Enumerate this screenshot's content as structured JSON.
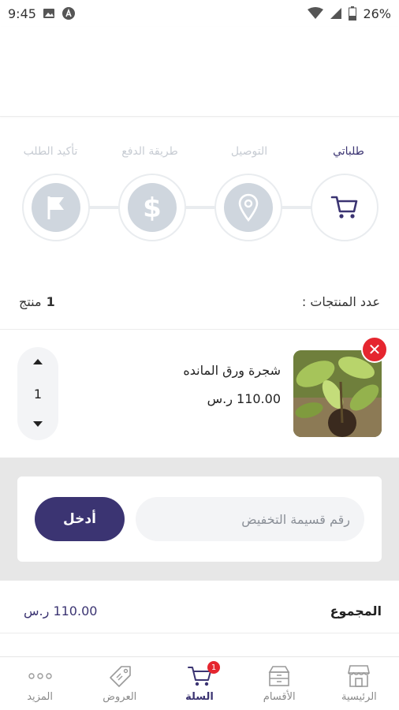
{
  "status_bar": {
    "time": "9:45",
    "battery": "26%",
    "icons": [
      "image-icon",
      "notification-a-icon",
      "wifi-icon",
      "signal-icon",
      "battery-icon"
    ]
  },
  "stepper": {
    "steps": [
      {
        "label": "طلباتي",
        "icon": "cart-icon",
        "active": true
      },
      {
        "label": "التوصيل",
        "icon": "location-pin-icon",
        "active": false
      },
      {
        "label": "طريقة الدفع",
        "icon": "dollar-icon",
        "active": false
      },
      {
        "label": "تأكيد الطلب",
        "icon": "flag-icon",
        "active": false
      }
    ]
  },
  "cart": {
    "count_label": "عدد المنتجات :",
    "count_number": "1",
    "count_unit": "منتج",
    "items": [
      {
        "name": "شجرة ورق المانده",
        "price": "110.00 ر.س",
        "quantity": "1"
      }
    ]
  },
  "coupon": {
    "placeholder": "رقم قسيمة التخفيض",
    "submit_label": "أدخل"
  },
  "total": {
    "label": "المجموع",
    "value": "110.00 ر.س"
  },
  "bottom_nav": {
    "items": [
      {
        "label": "الرئيسية",
        "icon": "store-icon",
        "active": false
      },
      {
        "label": "الأقسام",
        "icon": "categories-box-icon",
        "active": false
      },
      {
        "label": "السلة",
        "icon": "cart-icon",
        "active": true,
        "badge": "1"
      },
      {
        "label": "العروض",
        "icon": "tag-icon",
        "active": false
      },
      {
        "label": "المزيد",
        "icon": "more-dots-icon",
        "active": false
      }
    ]
  },
  "colors": {
    "primary": "#3b3472",
    "danger": "#e5262f",
    "inactive_step": "#cfd6de",
    "coupon_bg": "#e7e7e7"
  }
}
